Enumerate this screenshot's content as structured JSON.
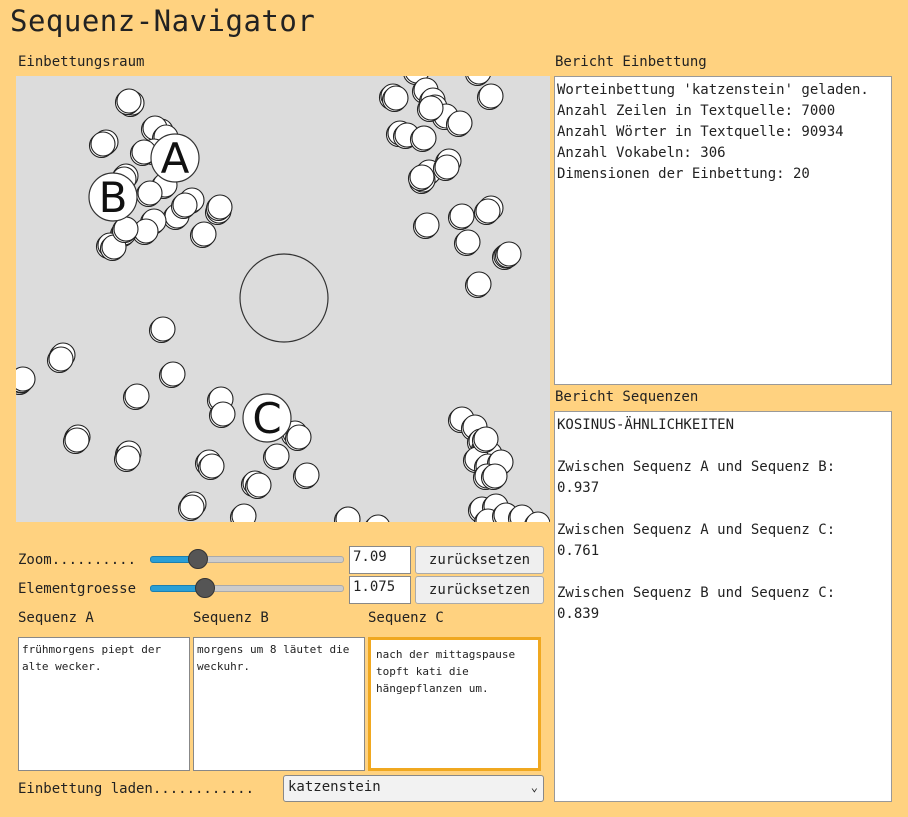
{
  "app": {
    "title": "Sequenz-Navigator"
  },
  "space": {
    "label": "Einbettungsraum",
    "markers": {
      "a": "A",
      "b": "B",
      "c": "C"
    }
  },
  "controls": {
    "zoom": {
      "label": "Zoom..........",
      "value": "7.09",
      "slider_level": 0.24,
      "reset": "zurücksetzen"
    },
    "size": {
      "label": "Elementgroesse",
      "value": "1.075",
      "slider_level": 0.28,
      "reset": "zurücksetzen"
    }
  },
  "sequences": {
    "a": {
      "label": "Sequenz A",
      "text": "frühmorgens piept der alte wecker."
    },
    "b": {
      "label": "Sequenz B",
      "text": "morgens um 8 läutet die weckuhr."
    },
    "c": {
      "label": "Sequenz C",
      "text": "nach der mittagspause topft kati die hängepflanzen um."
    }
  },
  "load": {
    "label": "Einbettung laden............",
    "selected": "katzenstein"
  },
  "report_embedding": {
    "label": "Bericht Einbettung",
    "text": "Worteinbettung 'katzenstein' geladen.\nAnzahl Zeilen in Textquelle: 7000\nAnzahl Wörter in Textquelle: 90934\nAnzahl Vokabeln: 306\nDimensionen der Einbettung: 20"
  },
  "report_sequences": {
    "label": "Bericht Sequenzen",
    "text": "KOSINUS-ÄHNLICHKEITEN\n\nZwischen Sequenz A und Sequenz B:\n0.937\n\nZwischen Sequenz A und Sequenz C:\n0.761\n\nZwischen Sequenz B und Sequenz C:\n0.839"
  },
  "colors": {
    "background": "#ffd280",
    "canvas": "#dcdcdc",
    "accent": "#f0a820",
    "slider": "#2a9fd6"
  }
}
